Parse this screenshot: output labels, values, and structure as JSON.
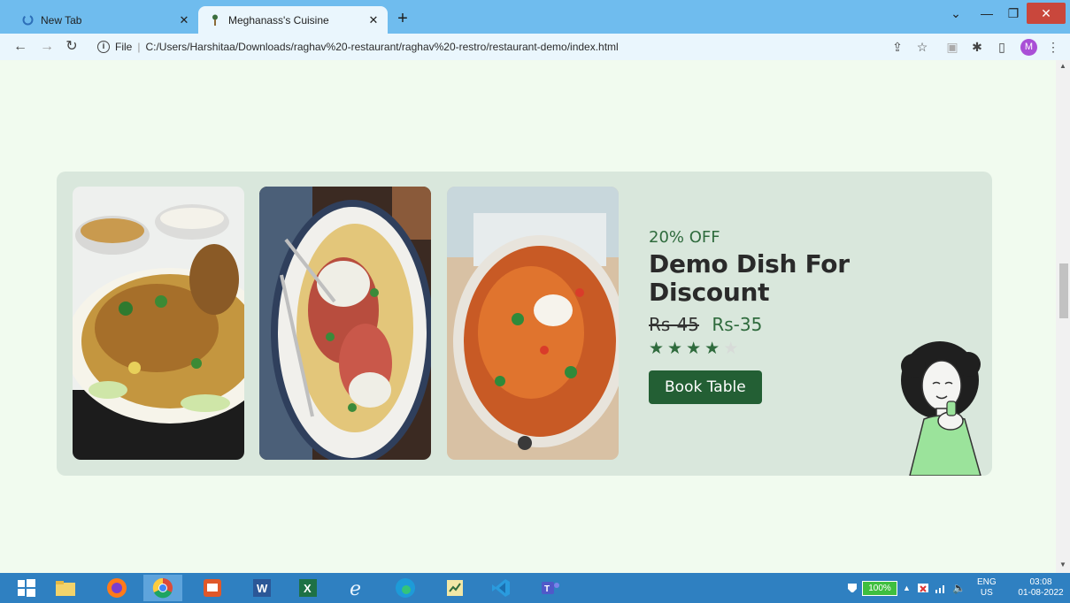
{
  "browser": {
    "tabs": [
      {
        "label": "New Tab",
        "active": false
      },
      {
        "label": "Meghanass's Cuisine",
        "active": true
      }
    ],
    "address": {
      "scheme_label": "File",
      "url": "C:/Users/Harshitaa/Downloads/raghav%20-restaurant/raghav%20-restro/restaurant-demo/index.html"
    },
    "profile_initial": "M"
  },
  "promo": {
    "discount": "20% OFF",
    "title": "Demo Dish For Discount",
    "old_price": "Rs-45",
    "new_price": "Rs-35",
    "rating": {
      "filled": 4,
      "total": 5
    },
    "button_label": "Book Table"
  },
  "taskbar": {
    "battery": "100%",
    "lang_top": "ENG",
    "lang_bottom": "US",
    "time": "03:08",
    "date": "01-08-2022"
  },
  "colors": {
    "accent": "#235f34",
    "page_bg": "#f1fbef",
    "card_bg": "#d9e7dc",
    "tab_bar": "#6fbcee"
  }
}
